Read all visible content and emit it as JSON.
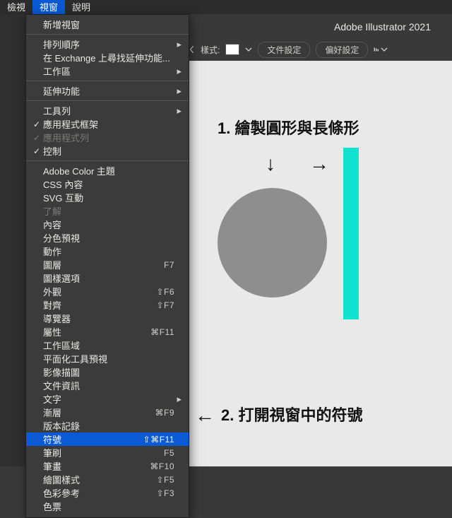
{
  "menubar": {
    "items": [
      {
        "label": "檢視",
        "open": false
      },
      {
        "label": "視窗",
        "open": true
      },
      {
        "label": "說明",
        "open": false
      }
    ]
  },
  "app_title": "Adobe Illustrator 2021",
  "toolbar": {
    "angle_icon": "angle-icon",
    "style_label": "樣式:",
    "doc_setup": "文件設定",
    "pref": "偏好設定"
  },
  "annotations": {
    "step1": "1. 繪製圓形與長條形",
    "step2": "2. 打開視窗中的符號",
    "arrow_down": "↓",
    "arrow_right": "→",
    "arrow_left": "←"
  },
  "menu": [
    {
      "type": "item",
      "label": "新增視窗",
      "chk": "",
      "sc": "",
      "sub": ""
    },
    {
      "type": "sep"
    },
    {
      "type": "item",
      "label": "排列順序",
      "chk": "",
      "sc": "",
      "sub": "▸"
    },
    {
      "type": "item",
      "label": "在 Exchange 上尋找延伸功能...",
      "chk": "",
      "sc": "",
      "sub": ""
    },
    {
      "type": "item",
      "label": "工作區",
      "chk": "",
      "sc": "",
      "sub": "▸"
    },
    {
      "type": "sep"
    },
    {
      "type": "item",
      "label": "延伸功能",
      "chk": "",
      "sc": "",
      "sub": "▸"
    },
    {
      "type": "sep"
    },
    {
      "type": "item",
      "label": "工具列",
      "chk": "",
      "sc": "",
      "sub": "▸"
    },
    {
      "type": "item",
      "label": "應用程式框架",
      "chk": "✓",
      "sc": "",
      "sub": ""
    },
    {
      "type": "item",
      "label": "應用程式列",
      "chk": "✓",
      "sc": "",
      "sub": "",
      "disabled": true
    },
    {
      "type": "item",
      "label": "控制",
      "chk": "✓",
      "sc": "",
      "sub": ""
    },
    {
      "type": "sep"
    },
    {
      "type": "item",
      "label": "Adobe Color 主題",
      "chk": "",
      "sc": "",
      "sub": ""
    },
    {
      "type": "item",
      "label": "CSS 內容",
      "chk": "",
      "sc": "",
      "sub": ""
    },
    {
      "type": "item",
      "label": "SVG 互動",
      "chk": "",
      "sc": "",
      "sub": ""
    },
    {
      "type": "item",
      "label": "了解",
      "chk": "",
      "sc": "",
      "sub": "",
      "disabled": true
    },
    {
      "type": "item",
      "label": "內容",
      "chk": "",
      "sc": "",
      "sub": ""
    },
    {
      "type": "item",
      "label": "分色預視",
      "chk": "",
      "sc": "",
      "sub": ""
    },
    {
      "type": "item",
      "label": "動作",
      "chk": "",
      "sc": "",
      "sub": ""
    },
    {
      "type": "item",
      "label": "圖層",
      "chk": "",
      "sc": "F7",
      "sub": ""
    },
    {
      "type": "item",
      "label": "圖樣選項",
      "chk": "",
      "sc": "",
      "sub": ""
    },
    {
      "type": "item",
      "label": "外觀",
      "chk": "",
      "sc": "⇧F6",
      "sub": ""
    },
    {
      "type": "item",
      "label": "對齊",
      "chk": "",
      "sc": "⇧F7",
      "sub": ""
    },
    {
      "type": "item",
      "label": "導覽器",
      "chk": "",
      "sc": "",
      "sub": ""
    },
    {
      "type": "item",
      "label": "屬性",
      "chk": "",
      "sc": "⌘F11",
      "sub": ""
    },
    {
      "type": "item",
      "label": "工作區域",
      "chk": "",
      "sc": "",
      "sub": ""
    },
    {
      "type": "item",
      "label": "平面化工具預視",
      "chk": "",
      "sc": "",
      "sub": ""
    },
    {
      "type": "item",
      "label": "影像描圖",
      "chk": "",
      "sc": "",
      "sub": ""
    },
    {
      "type": "item",
      "label": "文件資訊",
      "chk": "",
      "sc": "",
      "sub": ""
    },
    {
      "type": "item",
      "label": "文字",
      "chk": "",
      "sc": "",
      "sub": "▸"
    },
    {
      "type": "item",
      "label": "漸層",
      "chk": "",
      "sc": "⌘F9",
      "sub": ""
    },
    {
      "type": "item",
      "label": "版本記錄",
      "chk": "",
      "sc": "",
      "sub": ""
    },
    {
      "type": "item",
      "label": "符號",
      "chk": "",
      "sc": "⇧⌘F11",
      "sub": "",
      "hl": true
    },
    {
      "type": "item",
      "label": "筆刷",
      "chk": "",
      "sc": "F5",
      "sub": ""
    },
    {
      "type": "item",
      "label": "筆畫",
      "chk": "",
      "sc": "⌘F10",
      "sub": ""
    },
    {
      "type": "item",
      "label": "繪圖樣式",
      "chk": "",
      "sc": "⇧F5",
      "sub": ""
    },
    {
      "type": "item",
      "label": "色彩參考",
      "chk": "",
      "sc": "⇧F3",
      "sub": ""
    },
    {
      "type": "item",
      "label": "色票",
      "chk": "",
      "sc": "",
      "sub": ""
    }
  ]
}
